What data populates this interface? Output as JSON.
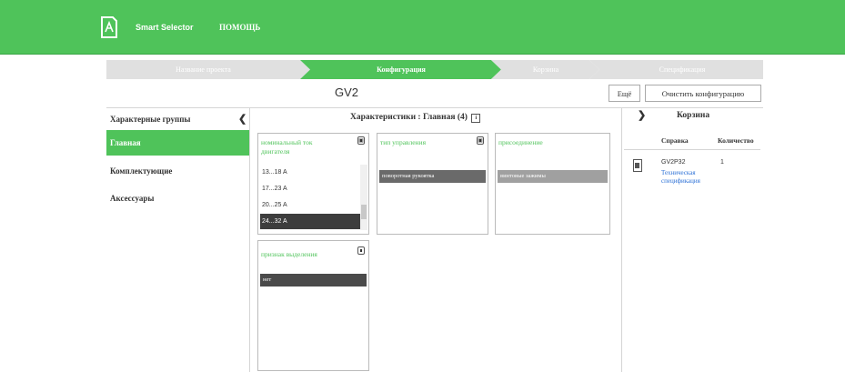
{
  "header": {
    "brand": "Smart Selector",
    "help": "ПОМОЩЬ",
    "bg_color": "#4fc35a"
  },
  "steps": [
    {
      "label": "Название проекта",
      "active": false
    },
    {
      "label": "Конфигурация",
      "active": true
    },
    {
      "label": "Корзина",
      "active": false
    },
    {
      "label": "Спецификация",
      "active": false
    }
  ],
  "toolbar": {
    "title": "GV2",
    "btn_more": "Ещё",
    "btn_clear": "Очистить конфигурацию"
  },
  "groups": {
    "title": "Характерные группы",
    "collapse_icon": "chevron-left-icon",
    "items": [
      {
        "label": "Главная",
        "active": true
      },
      {
        "label": "Комплектующие",
        "active": false
      },
      {
        "label": "Аксессуары",
        "active": false
      }
    ]
  },
  "characteristics": {
    "title": "Характеристики : Главная (4)",
    "info_icon": "info-icon",
    "cards": [
      {
        "title": "номинальный ток двигателя",
        "icon": "lock-icon",
        "options": [
          "13...18 A",
          "17...23 A",
          "20...25 A",
          "24...32 A"
        ],
        "selected": "24...32 A"
      },
      {
        "title": "тип управления",
        "icon": "lock-icon",
        "value": "поворотная рукоятка"
      },
      {
        "title": "присоединение",
        "value": "винтовые зажимы"
      },
      {
        "title": "признак выделения",
        "icon": "trash-icon",
        "value": "нет"
      }
    ]
  },
  "basket": {
    "title": "Корзина",
    "expand_icon": "chevron-right-icon",
    "col_ref": "Справка",
    "col_qty": "Количество",
    "item_ref": "GV2P32",
    "item_qty": "1",
    "item_link": "Техническая спецификация",
    "doc_icon": "document-icon"
  }
}
